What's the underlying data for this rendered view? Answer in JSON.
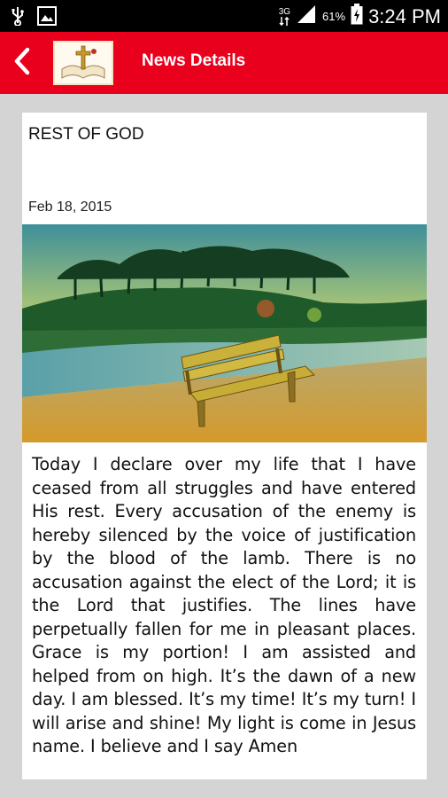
{
  "status_bar": {
    "network": "3G",
    "battery_percent": "61%",
    "time": "3:24 PM"
  },
  "app_bar": {
    "title": "News Details",
    "back_icon": "chevron-left-icon",
    "accent_color": "#e8001d"
  },
  "article": {
    "title": "REST OF GOD",
    "date": "Feb 18, 2015",
    "image_description_icon": "bench-landscape-image",
    "body": "Today I declare over my life that I have ceased from all struggles and have entered His rest. Every accusation of the enemy is hereby silenced by the voice of justification by the blood of the lamb. There is no accusation against the elect of the Lord; it is the Lord that justifies. The lines have perpetually fallen for me in pleasant places. Grace is my portion! I am assisted and helped from on high. It’s the dawn of a new day. I am blessed. It’s my time! It’s my turn! I will arise and shine! My light is come in Jesus name. I believe and I say Amen"
  }
}
